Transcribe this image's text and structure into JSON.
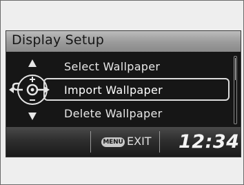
{
  "screen": {
    "title": "Display Setup"
  },
  "menu": {
    "items": [
      {
        "label": "Select Wallpaper"
      },
      {
        "label": "Import Wallpaper"
      },
      {
        "label": "Delete Wallpaper"
      }
    ],
    "selected_index": 1
  },
  "status_bar": {
    "menu_button_label": "MENU",
    "exit_label": "EXIT",
    "clock": "12:34"
  },
  "icons": {
    "selector_dial": "interface-dial-icon",
    "back": "back-arrow-icon",
    "enter": "enter-arrow-icon",
    "scroll_up": "up-arrow-icon",
    "scroll_down": "down-arrow-icon"
  },
  "colors": {
    "screen_background": "#161616",
    "title_bar": "#9a9a9a",
    "text": "#e8e8e8",
    "highlight_border": "#dcdcdc"
  }
}
